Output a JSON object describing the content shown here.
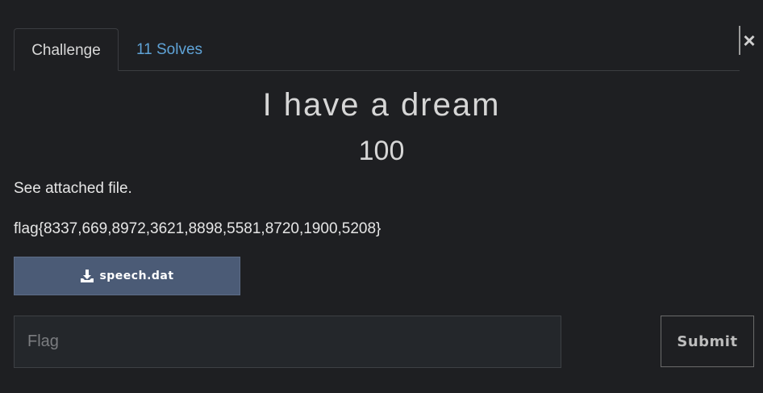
{
  "modal": {
    "close_label": "×",
    "tabs": [
      {
        "label": "Challenge",
        "active": true
      },
      {
        "label": "11 Solves",
        "active": false
      }
    ],
    "challenge": {
      "title": "I have a dream",
      "value": "100",
      "description": "See attached file.",
      "flag_text": "flag{8337,669,8972,3621,8898,5581,8720,1900,5208}",
      "file": {
        "icon": "download-icon",
        "label": "speech.dat"
      }
    },
    "submission": {
      "placeholder": "Flag",
      "value": "",
      "submit_label": "Submit"
    }
  },
  "colors": {
    "background": "#1e1f22",
    "accent_link": "#5fa3d7",
    "file_button": "#4b5b76"
  }
}
